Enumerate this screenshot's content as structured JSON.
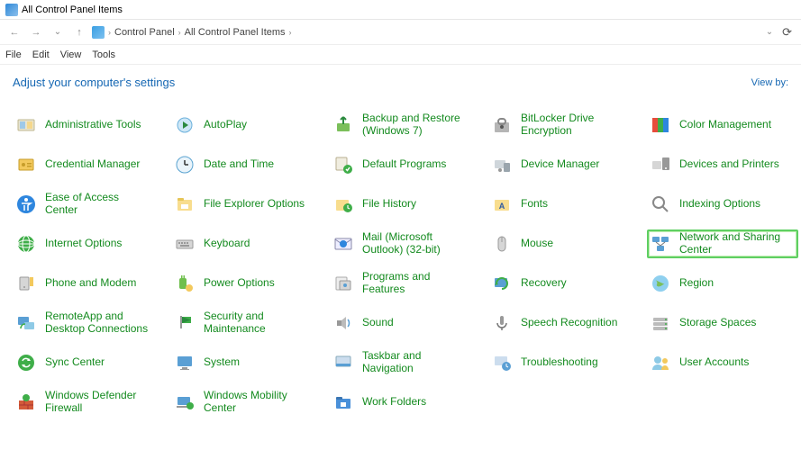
{
  "window": {
    "title": "All Control Panel Items"
  },
  "nav": {
    "crumbs": [
      "Control Panel",
      "All Control Panel Items"
    ]
  },
  "menu": {
    "items": [
      "File",
      "Edit",
      "View",
      "Tools"
    ]
  },
  "header": {
    "heading": "Adjust your computer's settings",
    "viewby": "View by:"
  },
  "items": [
    {
      "label": "Administrative Tools",
      "icon": "admin",
      "hl": false
    },
    {
      "label": "AutoPlay",
      "icon": "autoplay",
      "hl": false
    },
    {
      "label": "Backup and Restore (Windows 7)",
      "icon": "backup",
      "hl": false
    },
    {
      "label": "BitLocker Drive Encryption",
      "icon": "bitlocker",
      "hl": false
    },
    {
      "label": "Color Management",
      "icon": "color",
      "hl": false
    },
    {
      "label": "Credential Manager",
      "icon": "credential",
      "hl": false
    },
    {
      "label": "Date and Time",
      "icon": "datetime",
      "hl": false
    },
    {
      "label": "Default Programs",
      "icon": "defaults",
      "hl": false
    },
    {
      "label": "Device Manager",
      "icon": "devicemgr",
      "hl": false
    },
    {
      "label": "Devices and Printers",
      "icon": "devices",
      "hl": false
    },
    {
      "label": "Ease of Access Center",
      "icon": "ease",
      "hl": false
    },
    {
      "label": "File Explorer Options",
      "icon": "explorer",
      "hl": false
    },
    {
      "label": "File History",
      "icon": "filehist",
      "hl": false
    },
    {
      "label": "Fonts",
      "icon": "fonts",
      "hl": false
    },
    {
      "label": "Indexing Options",
      "icon": "indexing",
      "hl": false
    },
    {
      "label": "Internet Options",
      "icon": "internet",
      "hl": false
    },
    {
      "label": "Keyboard",
      "icon": "keyboard",
      "hl": false
    },
    {
      "label": "Mail (Microsoft Outlook) (32-bit)",
      "icon": "mail",
      "hl": false
    },
    {
      "label": "Mouse",
      "icon": "mouse",
      "hl": false
    },
    {
      "label": "Network and Sharing Center",
      "icon": "network",
      "hl": true
    },
    {
      "label": "Phone and Modem",
      "icon": "phone",
      "hl": false
    },
    {
      "label": "Power Options",
      "icon": "power",
      "hl": false
    },
    {
      "label": "Programs and Features",
      "icon": "programs",
      "hl": false
    },
    {
      "label": "Recovery",
      "icon": "recovery",
      "hl": false
    },
    {
      "label": "Region",
      "icon": "region",
      "hl": false
    },
    {
      "label": "RemoteApp and Desktop Connections",
      "icon": "remote",
      "hl": false
    },
    {
      "label": "Security and Maintenance",
      "icon": "security",
      "hl": false
    },
    {
      "label": "Sound",
      "icon": "sound",
      "hl": false
    },
    {
      "label": "Speech Recognition",
      "icon": "speech",
      "hl": false
    },
    {
      "label": "Storage Spaces",
      "icon": "storage",
      "hl": false
    },
    {
      "label": "Sync Center",
      "icon": "sync",
      "hl": false
    },
    {
      "label": "System",
      "icon": "system",
      "hl": false
    },
    {
      "label": "Taskbar and Navigation",
      "icon": "taskbar",
      "hl": false
    },
    {
      "label": "Troubleshooting",
      "icon": "troubleshoot",
      "hl": false
    },
    {
      "label": "User Accounts",
      "icon": "users",
      "hl": false
    },
    {
      "label": "Windows Defender Firewall",
      "icon": "firewall",
      "hl": false
    },
    {
      "label": "Windows Mobility Center",
      "icon": "mobility",
      "hl": false
    },
    {
      "label": "Work Folders",
      "icon": "workfolders",
      "hl": false
    }
  ]
}
